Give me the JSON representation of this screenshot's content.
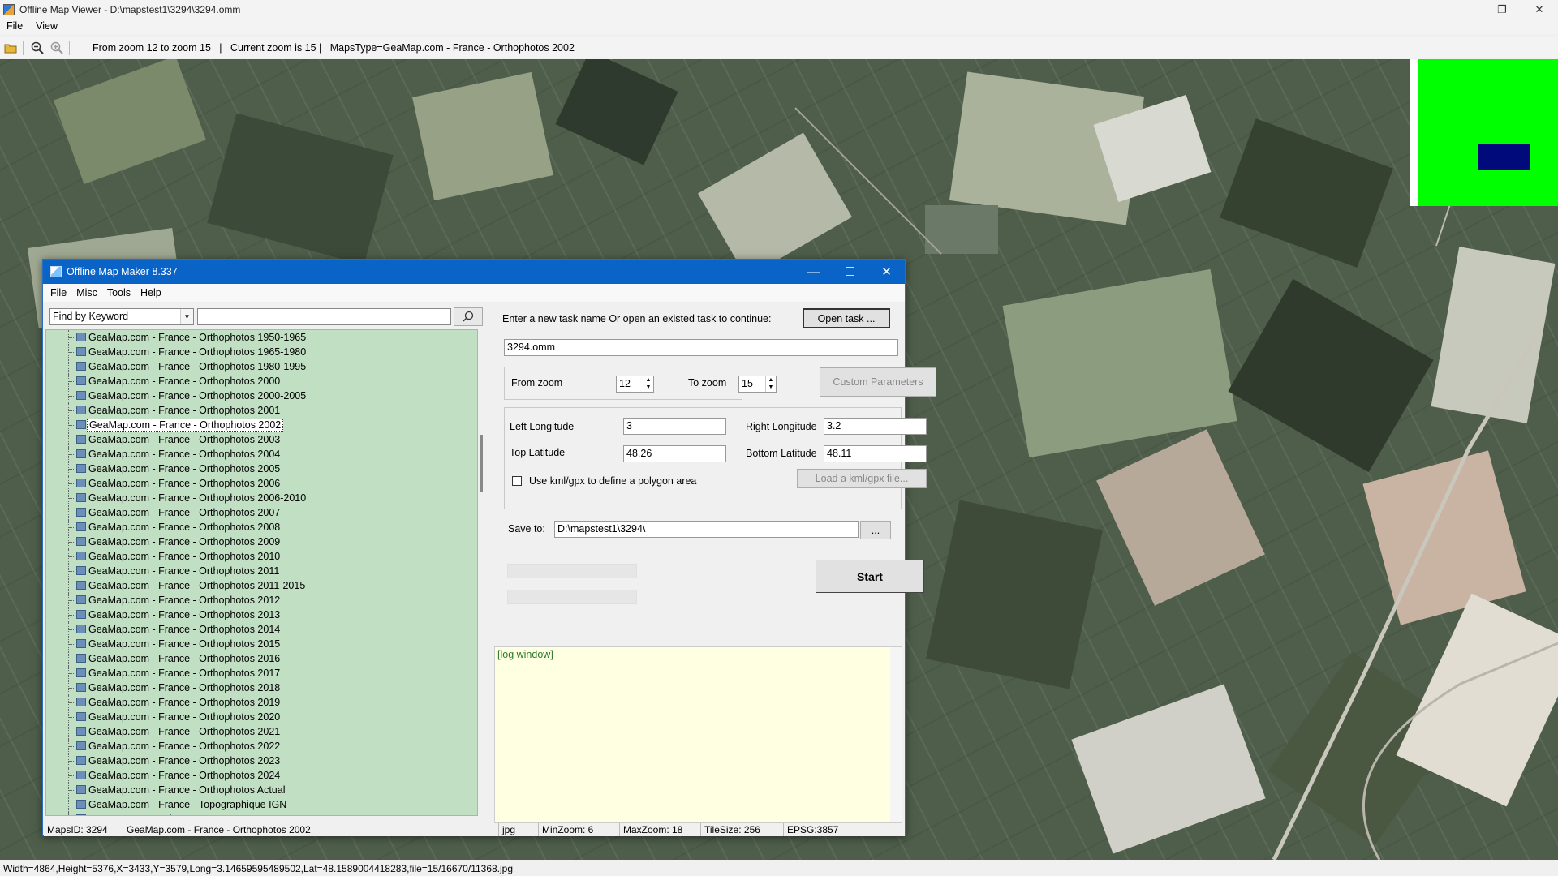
{
  "viewer": {
    "title": "Offline Map Viewer - D:\\mapstest1\\3294\\3294.omm",
    "menu": [
      "File",
      "View"
    ],
    "toolbar_status": "From zoom 12 to zoom 15   |   Current zoom is 15 |   MapsType=GeaMap.com - France - Orthophotos 2002",
    "statusbar": "Width=4864,Height=5376,X=3433,Y=3579,Long=3.14659595489502,Lat=48.1589004418283,file=15/16670/11368.jpg"
  },
  "dialog": {
    "title": "Offline Map Maker 8.337",
    "menu": [
      "File",
      "Misc",
      "Tools",
      "Help"
    ],
    "find_by": "Find by Keyword",
    "search_value": "",
    "tree_items": [
      "GeaMap.com - France - Orthophotos 1950-1965",
      "GeaMap.com - France - Orthophotos 1965-1980",
      "GeaMap.com - France - Orthophotos 1980-1995",
      "GeaMap.com - France - Orthophotos 2000",
      "GeaMap.com - France - Orthophotos 2000-2005",
      "GeaMap.com - France - Orthophotos 2001",
      "GeaMap.com - France - Orthophotos 2002",
      "GeaMap.com - France - Orthophotos 2003",
      "GeaMap.com - France - Orthophotos 2004",
      "GeaMap.com - France - Orthophotos 2005",
      "GeaMap.com - France - Orthophotos 2006",
      "GeaMap.com - France - Orthophotos 2006-2010",
      "GeaMap.com - France - Orthophotos 2007",
      "GeaMap.com - France - Orthophotos 2008",
      "GeaMap.com - France - Orthophotos 2009",
      "GeaMap.com - France - Orthophotos 2010",
      "GeaMap.com - France - Orthophotos 2011",
      "GeaMap.com - France - Orthophotos 2011-2015",
      "GeaMap.com - France - Orthophotos 2012",
      "GeaMap.com - France - Orthophotos 2013",
      "GeaMap.com - France - Orthophotos 2014",
      "GeaMap.com - France - Orthophotos 2015",
      "GeaMap.com - France - Orthophotos 2016",
      "GeaMap.com - France - Orthophotos 2017",
      "GeaMap.com - France - Orthophotos 2018",
      "GeaMap.com - France - Orthophotos 2019",
      "GeaMap.com - France - Orthophotos 2020",
      "GeaMap.com - France - Orthophotos 2021",
      "GeaMap.com - France - Orthophotos 2022",
      "GeaMap.com - France - Orthophotos 2023",
      "GeaMap.com - France - Orthophotos 2024",
      "GeaMap.com - France - Orthophotos Actual",
      "GeaMap.com - France - Topographique IGN",
      "GeaMap.com - Italy - IGM"
    ],
    "selected_item": "GeaMap.com - France - Orthophotos 2002",
    "task_prompt": "Enter a new task name Or open an existed task to continue:",
    "open_task": "Open task ...",
    "task_name": "3294.omm",
    "from_zoom_label": "From zoom",
    "from_zoom": "12",
    "to_zoom_label": "To zoom",
    "to_zoom": "15",
    "custom_params": "Custom Parameters",
    "left_lon_label": "Left Longitude",
    "left_lon": "3",
    "right_lon_label": "Right Longitude",
    "right_lon": "3.2",
    "top_lat_label": "Top Latitude",
    "top_lat": "48.26",
    "bottom_lat_label": "Bottom Latitude",
    "bottom_lat": "48.11",
    "kml_label": "Use kml/gpx to define a polygon area",
    "load_kml": "Load a kml/gpx file...",
    "save_to_label": "Save to:",
    "save_to": "D:\\mapstest1\\3294\\",
    "browse": "...",
    "start": "Start",
    "log": "[log window]",
    "status": {
      "maps_id": "MapsID: 3294",
      "map_name": "GeaMap.com - France - Orthophotos 2002",
      "format": "jpg",
      "min_zoom": "MinZoom: 6",
      "max_zoom": "MaxZoom: 18",
      "tile_size": "TileSize: 256",
      "epsg": "EPSG:3857"
    }
  },
  "colors": {
    "tree_bg": "#c1dfc3",
    "log_bg": "#ffffe1",
    "dialog_title": "#0a64c8",
    "minimap_bg": "#00ff00",
    "minimap_view": "#000a7a"
  }
}
